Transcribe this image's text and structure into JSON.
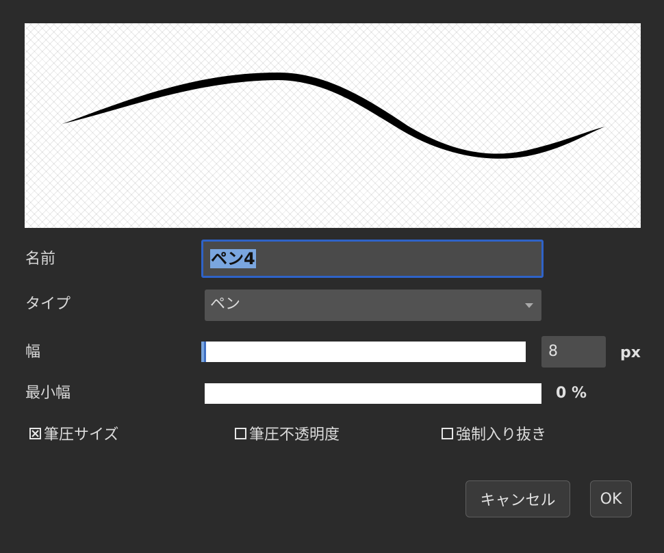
{
  "preview": {
    "icon": "brush-stroke-preview"
  },
  "fields": {
    "name_label": "名前",
    "name_value": "ペン4",
    "type_label": "タイプ",
    "type_value": "ペン",
    "width_label": "幅",
    "width_value": "8",
    "width_unit": "px",
    "width_slider_fraction": 0.01,
    "min_width_label": "最小幅",
    "min_width_value": "0 %",
    "min_width_slider_fraction": 0.0
  },
  "checkboxes": {
    "pressure_size": {
      "label": "筆圧サイズ",
      "checked": true
    },
    "pressure_opacity": {
      "label": "筆圧不透明度",
      "checked": false
    },
    "force_taper": {
      "label": "強制入り抜き",
      "checked": false
    }
  },
  "buttons": {
    "cancel": "キャンセル",
    "ok": "OK"
  },
  "colors": {
    "background": "#2b2b2b",
    "focus_border": "#2f63c8",
    "selection": "#7aa6df"
  }
}
